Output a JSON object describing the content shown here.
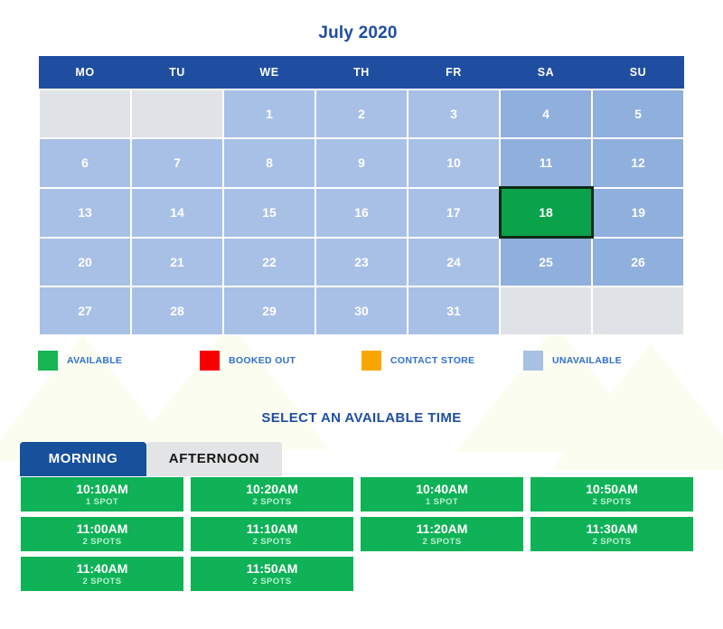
{
  "calendar": {
    "title": "July 2020",
    "weekday_headers": [
      "MO",
      "TU",
      "WE",
      "TH",
      "FR",
      "SA",
      "SU"
    ],
    "weeks": [
      [
        {
          "day": "",
          "state": "empty"
        },
        {
          "day": "",
          "state": "empty"
        },
        {
          "day": "1",
          "state": "unavailable"
        },
        {
          "day": "2",
          "state": "unavailable"
        },
        {
          "day": "3",
          "state": "unavailable"
        },
        {
          "day": "4",
          "state": "unavailable-weekend"
        },
        {
          "day": "5",
          "state": "unavailable-weekend"
        }
      ],
      [
        {
          "day": "6",
          "state": "unavailable"
        },
        {
          "day": "7",
          "state": "unavailable"
        },
        {
          "day": "8",
          "state": "unavailable"
        },
        {
          "day": "9",
          "state": "unavailable"
        },
        {
          "day": "10",
          "state": "unavailable"
        },
        {
          "day": "11",
          "state": "unavailable-weekend"
        },
        {
          "day": "12",
          "state": "unavailable-weekend"
        }
      ],
      [
        {
          "day": "13",
          "state": "unavailable"
        },
        {
          "day": "14",
          "state": "unavailable"
        },
        {
          "day": "15",
          "state": "unavailable"
        },
        {
          "day": "16",
          "state": "unavailable"
        },
        {
          "day": "17",
          "state": "unavailable"
        },
        {
          "day": "18",
          "state": "selected"
        },
        {
          "day": "19",
          "state": "unavailable-weekend"
        }
      ],
      [
        {
          "day": "20",
          "state": "unavailable"
        },
        {
          "day": "21",
          "state": "unavailable"
        },
        {
          "day": "22",
          "state": "unavailable"
        },
        {
          "day": "23",
          "state": "unavailable"
        },
        {
          "day": "24",
          "state": "unavailable"
        },
        {
          "day": "25",
          "state": "unavailable-weekend"
        },
        {
          "day": "26",
          "state": "unavailable-weekend"
        }
      ],
      [
        {
          "day": "27",
          "state": "unavailable"
        },
        {
          "day": "28",
          "state": "unavailable"
        },
        {
          "day": "29",
          "state": "unavailable"
        },
        {
          "day": "30",
          "state": "unavailable"
        },
        {
          "day": "31",
          "state": "unavailable"
        },
        {
          "day": "",
          "state": "empty"
        },
        {
          "day": "",
          "state": "empty"
        }
      ]
    ],
    "selected_day": "18"
  },
  "legend": {
    "items": [
      {
        "label": "AVAILABLE",
        "color": "#16b552",
        "swatch": "available"
      },
      {
        "label": "BOOKED OUT",
        "color": "#fb0000",
        "swatch": "booked"
      },
      {
        "label": "CONTACT STORE",
        "color": "#fba600",
        "swatch": "contact"
      },
      {
        "label": "UNAVAILABLE",
        "color": "#a8c0e6",
        "swatch": "unavailable"
      }
    ]
  },
  "time_section": {
    "heading": "SELECT AN AVAILABLE TIME",
    "tabs": [
      {
        "label": "MORNING",
        "active": true
      },
      {
        "label": "AFTERNOON",
        "active": false
      }
    ],
    "slots": [
      {
        "time": "10:10AM",
        "spots": "1 SPOT"
      },
      {
        "time": "10:20AM",
        "spots": "2 SPOTS"
      },
      {
        "time": "10:40AM",
        "spots": "1 SPOT"
      },
      {
        "time": "10:50AM",
        "spots": "2 SPOTS"
      },
      {
        "time": "11:00AM",
        "spots": "2 SPOTS"
      },
      {
        "time": "11:10AM",
        "spots": "2 SPOTS"
      },
      {
        "time": "11:20AM",
        "spots": "2 SPOTS"
      },
      {
        "time": "11:30AM",
        "spots": "2 SPOTS"
      },
      {
        "time": "11:40AM",
        "spots": "2 SPOTS"
      },
      {
        "time": "11:50AM",
        "spots": "2 SPOTS"
      }
    ]
  },
  "colors": {
    "brand_blue": "#1f4ea1",
    "available_green": "#0fb257",
    "unavailable_blue": "#a8c0e6",
    "unavailable_weekend_blue": "#8fafdd",
    "empty_grey": "#dfe3e8",
    "selected_border": "#0d2b14"
  }
}
